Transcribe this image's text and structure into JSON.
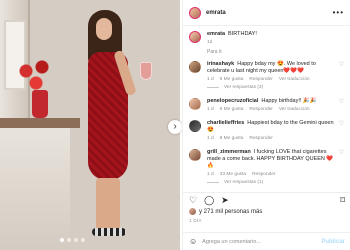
{
  "post": {
    "username": "emrata",
    "more_icon": "more-horizontal-icon"
  },
  "caption": {
    "username": "emrata",
    "text": "BIRTHDAY!",
    "time": "1d"
  },
  "translated_note": "Para ti",
  "comments": [
    {
      "username": "irinashayk",
      "text": "Happy bday my 😍. We loved to celebrate u last night my queen❤️❤️❤️",
      "time": "1 d",
      "likes": "6 Me gusta",
      "reply": "Responder",
      "translate": "Ver traducción",
      "view_replies": "Ver respuestas (3)"
    },
    {
      "username": "penelopecruzoficial",
      "text": "Happy birthday!! 🎉🎉",
      "time": "1 d",
      "likes": "6 Me gusta",
      "reply": "Responder",
      "translate": "Ver traducción"
    },
    {
      "username": "charlielieffries",
      "text": "Happiest bday to the Gemini queen 😍",
      "time": "1 d",
      "likes": "8 Me gusta",
      "reply": "Responder"
    },
    {
      "username": "grill_zimmerman",
      "text": "I fucking LOVE that cigarettes made a come back. HAPPY BIRTHDAY QUEEN ❤️🔥",
      "time": "1 d",
      "likes": "33 Me gusta",
      "reply": "Responder",
      "view_replies": "Ver respuestas (1)"
    }
  ],
  "actions": {
    "like_icon": "heart-icon",
    "comment_icon": "comment-icon",
    "share_icon": "share-icon",
    "save_icon": "bookmark-icon"
  },
  "likes_text": "y 271 mil personas más",
  "likes_prefix": "",
  "date": "1 DÍA",
  "add_comment": {
    "placeholder": "Agrega un comentario...",
    "post_label": "Publicar"
  },
  "photo": {
    "carousel_total": 4,
    "carousel_active": 0
  }
}
